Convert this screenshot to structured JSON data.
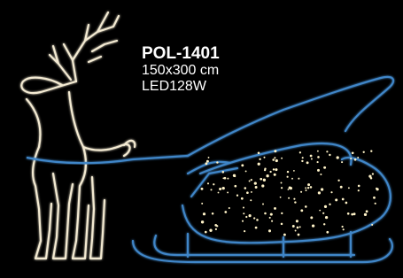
{
  "product": {
    "code": "POL-1401",
    "size": "150x300 cm",
    "power": "LED128W"
  },
  "colors": {
    "background": "#000000",
    "reindeer_outline": "#f3ead2",
    "sleigh_outline": "#3f86c8",
    "sleigh_dots": "#fff3c8"
  },
  "illustration": {
    "subject": "LED rope-light reindeer pulling a sleigh",
    "reindeer": "warm-white outline",
    "sleigh": "blue outline filled with warm-white dot lights"
  }
}
